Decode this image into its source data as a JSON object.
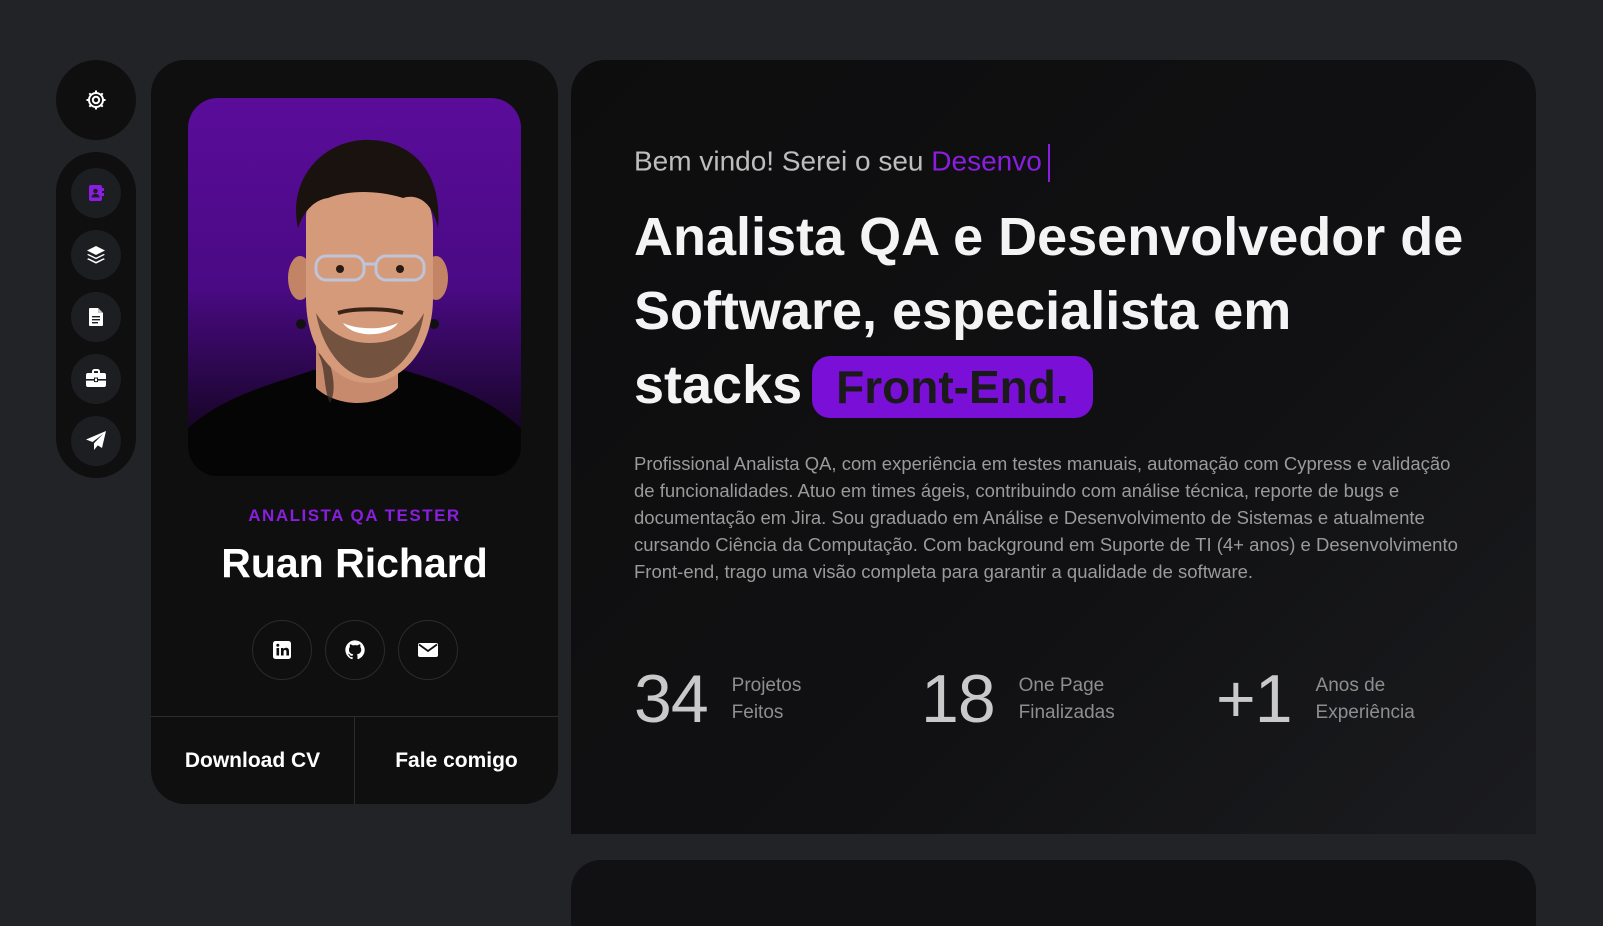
{
  "settings": {
    "icon": "gear-icon"
  },
  "nav": {
    "items": [
      {
        "icon": "contact-book-icon",
        "active": true
      },
      {
        "icon": "layers-icon",
        "active": false
      },
      {
        "icon": "document-icon",
        "active": false
      },
      {
        "icon": "briefcase-icon",
        "active": false
      },
      {
        "icon": "paper-plane-icon",
        "active": false
      }
    ]
  },
  "profile": {
    "role": "ANALISTA QA TESTER",
    "name": "Ruan Richard",
    "socials": [
      "linkedin-icon",
      "github-icon",
      "email-icon"
    ],
    "download_label": "Download CV",
    "contact_label": "Fale comigo"
  },
  "hero": {
    "greeting_prefix": "Bem vindo! Serei o seu ",
    "greeting_typed": "Desenvo",
    "headline_line1": "Analista QA e Desenvolvedor de",
    "headline_line2": "Software, especialista em",
    "headline_line3": "stacks",
    "highlight": "Front-End.",
    "description": "Profissional Analista QA, com experiência em testes manuais, automação com Cypress e validação de funcionalidades. Atuo em times ágeis, contribuindo com análise técnica, reporte de bugs e documentação em Jira. Sou graduado em Análise e Desenvolvimento de Sistemas e atualmente cursando Ciência da Computação. Com background em Suporte de TI (4+ anos) e Desenvolvimento Front-end, trago uma visão completa para garantir a qualidade de software."
  },
  "stats": [
    {
      "value": "34",
      "label_1": "Projetos",
      "label_2": "Feitos"
    },
    {
      "value": "18",
      "label_1": "One Page",
      "label_2": "Finalizadas"
    },
    {
      "value": "+1",
      "label_1": "Anos de",
      "label_2": "Experiência"
    }
  ],
  "colors": {
    "accent": "#8a1ee0",
    "highlight_bg": "#7a10d8",
    "page_bg": "#222326",
    "card_bg": "#0f0f10"
  }
}
